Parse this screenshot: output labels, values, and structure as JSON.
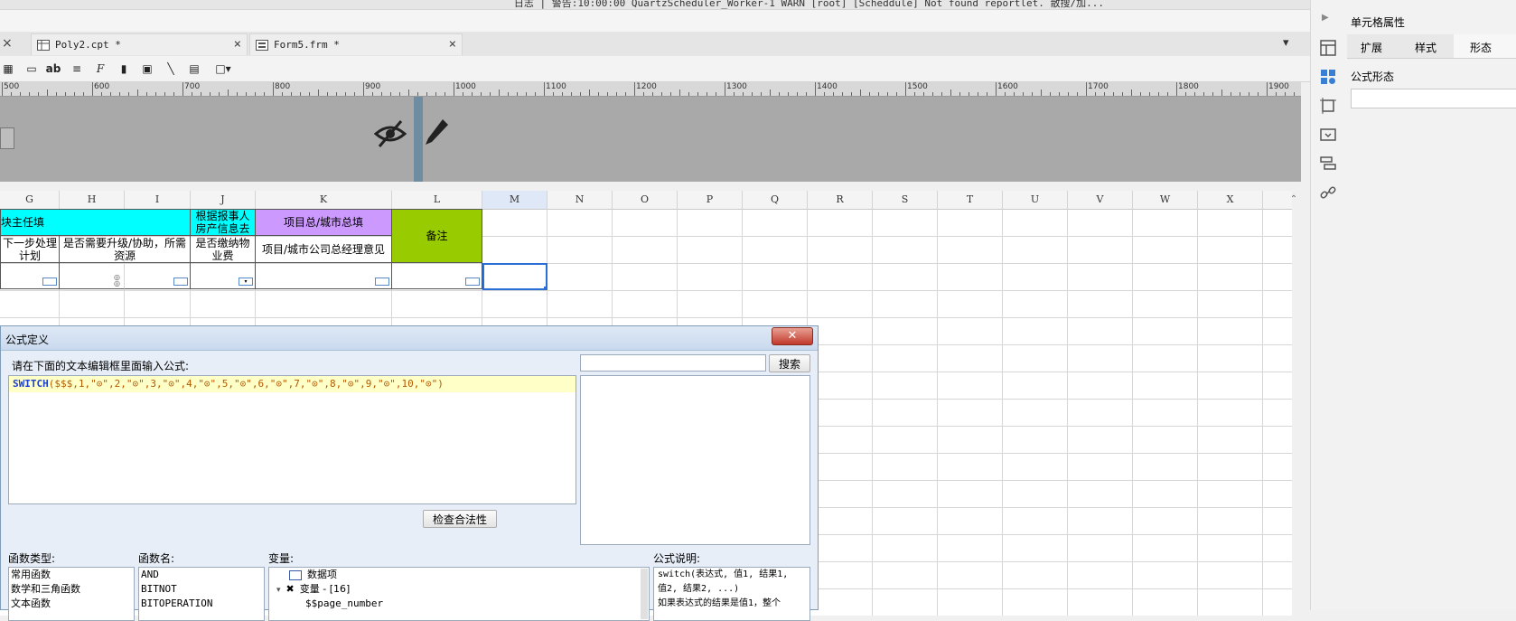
{
  "top": {
    "log_text": "日志 | 警告:10:00:00 QuartzScheduler_Worker-1 WARN [root] [Scheddule] Not found reportlet. 散搜/加..."
  },
  "tabs": [
    {
      "label": "Poly2.cpt *"
    },
    {
      "label": "Form5.frm *"
    }
  ],
  "ruler": {
    "labels": [
      "500",
      "600",
      "700",
      "800",
      "900",
      "1000",
      "1100",
      "1200",
      "1300",
      "1400",
      "1500",
      "1600",
      "1700",
      "1800",
      "1900"
    ]
  },
  "sheet": {
    "columns": [
      "G",
      "H",
      "I",
      "J",
      "K",
      "L",
      "M",
      "N",
      "O",
      "P",
      "Q",
      "R",
      "S",
      "T",
      "U",
      "V",
      "W",
      "X"
    ],
    "header_cells": {
      "fill_in_by": "块主任填",
      "per_report": "根据报事人房产信息去",
      "project_city": "项目总/城市总填",
      "remark": "备注",
      "next_plan": "下一步处理计划",
      "need_upgrade": "是否需要升级/协助，所需资源",
      "property_fee": "是否缴纳物业费",
      "manager_opinion": "项目/城市公司总经理意见"
    }
  },
  "properties": {
    "title": "单元格属性",
    "tabs": [
      "扩展",
      "样式",
      "形态"
    ],
    "active_tab": "形态",
    "field_label": "公式形态"
  },
  "dialog": {
    "title": "公式定义",
    "instruction": "请在下面的文本编辑框里面输入公式:",
    "formula_func": "SWITCH",
    "formula_args": "($$$,1,\"⊙\",2,\"⊙\",3,\"⊙\",4,\"⊙\",5,\"⊙\",6,\"⊙\",7,\"⊙\",8,\"⊙\",9,\"⊙\",10,\"⊙\")",
    "search_button": "搜索",
    "check_button": "检查合法性",
    "function_types_label": "函数类型:",
    "function_types": [
      "常用函数",
      "数学和三角函数",
      "文本函数"
    ],
    "function_names_label": "函数名:",
    "function_names": [
      "AND",
      "BITNOT",
      "BITOPERATION"
    ],
    "variables_label": "变量:",
    "variables": [
      "数据项",
      "变量 - [16]",
      "$$page_number"
    ],
    "description_label": "公式说明:",
    "description_lines": [
      "switch(表达式, 值1, 结果1,",
      "值2, 结果2, ...)",
      "如果表达式的结果是值1，整个"
    ]
  },
  "colors": {
    "cyan_header": "#00ffff",
    "purple_header": "#cc99ff",
    "green_header": "#99cc00",
    "formula_bg": "#ffffc8",
    "selection": "#2a6fd6"
  }
}
